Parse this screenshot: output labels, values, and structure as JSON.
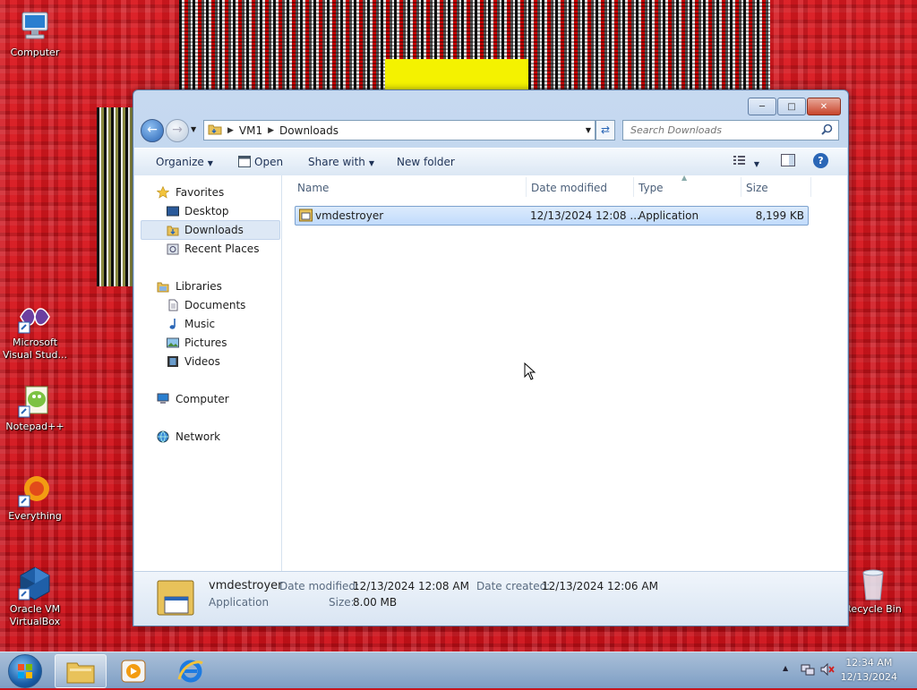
{
  "desktop": {
    "icons": [
      {
        "label": "Computer"
      },
      {
        "label": "Microsoft Visual Stud..."
      },
      {
        "label": "Notepad++"
      },
      {
        "label": "Everything"
      },
      {
        "label": "Oracle VM VirtualBox"
      },
      {
        "label": "Recycle Bin"
      }
    ]
  },
  "window": {
    "address": {
      "segments": [
        "VM1",
        "Downloads"
      ]
    },
    "search": {
      "placeholder": "Search Downloads"
    },
    "toolbar": {
      "organize": "Organize",
      "open": "Open",
      "share_with": "Share with",
      "new_folder": "New folder"
    },
    "nav": {
      "favorites": "Favorites",
      "desktop": "Desktop",
      "downloads": "Downloads",
      "recent_places": "Recent Places",
      "libraries": "Libraries",
      "documents": "Documents",
      "music": "Music",
      "pictures": "Pictures",
      "videos": "Videos",
      "computer": "Computer",
      "network": "Network"
    },
    "columns": {
      "name": "Name",
      "date_modified": "Date modified",
      "type": "Type",
      "size": "Size"
    },
    "files": [
      {
        "name": "vmdestroyer",
        "date_modified": "12/13/2024 12:08 ...",
        "type": "Application",
        "size": "8,199 KB"
      }
    ],
    "details": {
      "name": "vmdestroyer",
      "type": "Application",
      "date_modified_label": "Date modified:",
      "date_modified": "12/13/2024 12:08 AM",
      "date_created_label": "Date created:",
      "date_created": "12/13/2024 12:06 AM",
      "size_label": "Size:",
      "size": "8.00 MB"
    }
  },
  "taskbar": {
    "clock_time": "12:34 AM",
    "clock_date": "12/13/2024"
  }
}
